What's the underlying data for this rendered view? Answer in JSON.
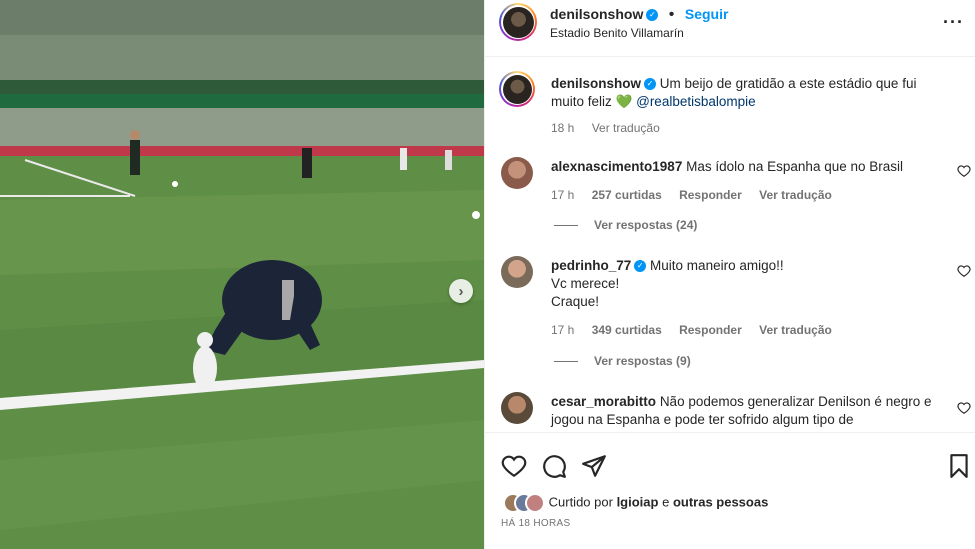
{
  "header": {
    "username": "denilsonshow",
    "verified": true,
    "follow_label": "Seguir",
    "location": "Estadio Benito Villamarín",
    "more_icon": "more-horizontal-icon"
  },
  "media": {
    "next_icon": "chevron-right-icon"
  },
  "caption": {
    "username": "denilsonshow",
    "text": "Um beijo de gratidão a este estádio que fui muito feliz 💚",
    "mention": "@realbetisbalompie",
    "time": "18 h",
    "translate": "Ver tradução"
  },
  "comments": [
    {
      "username": "alexnascimento1987",
      "text": "Mas ídolo na Espanha que no Brasil",
      "time": "17 h",
      "likes": "257 curtidas",
      "reply": "Responder",
      "translate": "Ver tradução",
      "view_replies": "Ver respostas (24)",
      "avatar_color": "#8a5a4a"
    },
    {
      "username": "pedrinho_77",
      "verified": true,
      "text_lines": [
        "Muito maneiro amigo!!",
        "Vc merece!",
        "Craque!"
      ],
      "time": "17 h",
      "likes": "349 curtidas",
      "reply": "Responder",
      "translate": "Ver tradução",
      "view_replies": "Ver respostas (9)",
      "avatar_color": "#7a6a5a"
    },
    {
      "username": "cesar_morabitto",
      "text": "Não podemos generalizar Denilson é negro e jogou na Espanha e pode ter sofrido algum tipo de",
      "avatar_color": "#5a4a3a"
    }
  ],
  "actions": {
    "like_icon": "heart-icon",
    "comment_icon": "comment-icon",
    "share_icon": "share-icon",
    "save_icon": "bookmark-icon"
  },
  "likes": {
    "prefix": "Curtido por",
    "user": "lgioiap",
    "connector": "e",
    "others": "outras pessoas"
  },
  "posted": "HÁ 18 HORAS",
  "colors": {
    "accent": "#0095f6",
    "muted": "#737373",
    "mention": "#00376b"
  }
}
